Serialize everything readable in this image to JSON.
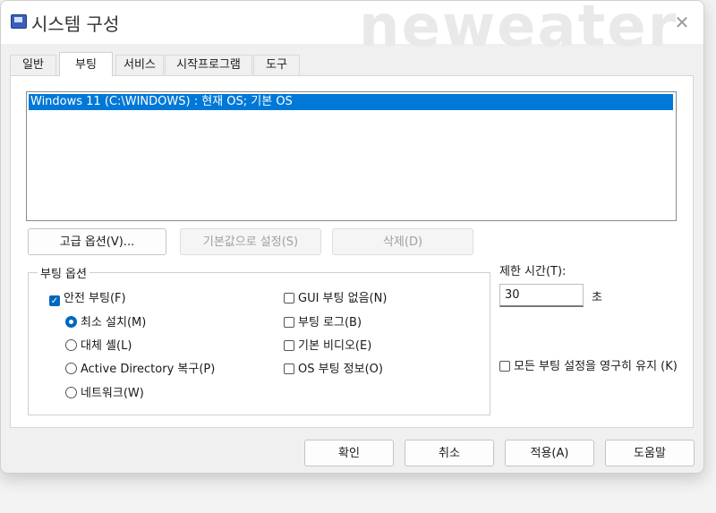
{
  "window": {
    "title": "시스템 구성",
    "watermark": "neweater"
  },
  "tabs": [
    {
      "label": "일반"
    },
    {
      "label": "부팅"
    },
    {
      "label": "서비스"
    },
    {
      "label": "시작프로그램"
    },
    {
      "label": "도구"
    }
  ],
  "boot": {
    "os_entries": [
      "Windows 11 (C:\\WINDOWS) : 현재 OS; 기본 OS"
    ],
    "buttons": {
      "advanced": "고급 옵션(V)...",
      "set_default": "기본값으로 설정(S)",
      "delete": "삭제(D)"
    },
    "boot_options": {
      "group_label": "부팅 옵션",
      "safe_boot": "안전 부팅(F)",
      "minimal": "최소 설치(M)",
      "alternate_shell": "대체 셸(L)",
      "active_directory": "Active Directory 복구(P)",
      "network": "네트워크(W)",
      "no_gui": "GUI 부팅 없음(N)",
      "boot_log": "부팅 로그(B)",
      "base_video": "기본 비디오(E)",
      "os_boot_info": "OS 부팅 정보(O)"
    },
    "timeout": {
      "label": "제한 시간(T):",
      "value": "30",
      "unit": "초"
    },
    "persist": "모든 부팅 설정을 영구히 유지 (K)"
  },
  "footer": {
    "ok": "확인",
    "cancel": "취소",
    "apply": "적용(A)",
    "help": "도움말"
  },
  "colors": {
    "accent": "#0078d7",
    "checkbox": "#0067c0"
  }
}
